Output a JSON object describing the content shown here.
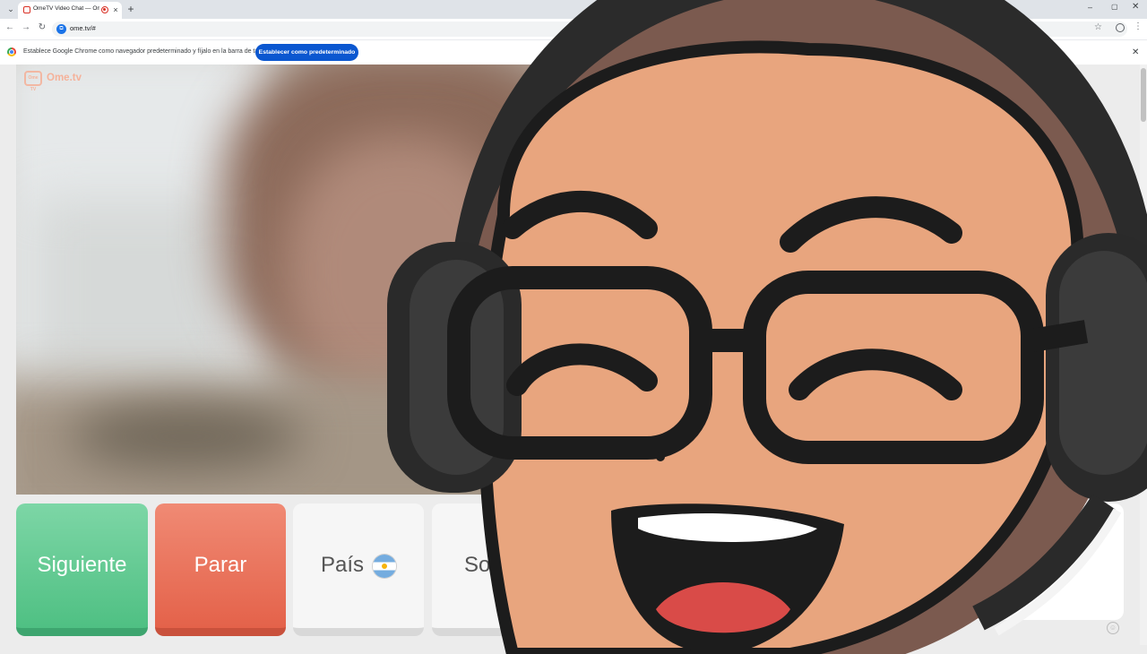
{
  "browser": {
    "tab": {
      "title": "OmeTV Video Chat — Omegle",
      "close_icon": "×"
    },
    "new_tab_icon": "+",
    "tab_list_icon": "⌄",
    "window": {
      "minimize": "–",
      "maximize": "▢",
      "close": "✕"
    },
    "nav": {
      "back": "←",
      "forward": "→",
      "reload": "↻"
    },
    "url": "ome.tv/#",
    "star_icon": "☆",
    "menu_icon": "⋮",
    "infobar": {
      "text": "Establece Google Chrome como navegador predeterminado y fíjalo en la barra de tareas",
      "button": "Establecer como predeterminado",
      "close": "✕"
    }
  },
  "site": {
    "brand": "Ome.tv",
    "brand_icon": "Ome TV",
    "buttons": {
      "next": "Siguiente",
      "stop": "Parar",
      "country": "País",
      "gender": "Soy"
    },
    "country_flag": "argentina-flag-icon",
    "emoji_icon": "☺"
  },
  "colors": {
    "next": "#5cc98f",
    "stop": "#e86d55",
    "chrome_blue": "#0b57d0",
    "brand": "#f5af96"
  },
  "overlay": {
    "description_icon": "streamer-avatar-headset-icon"
  }
}
